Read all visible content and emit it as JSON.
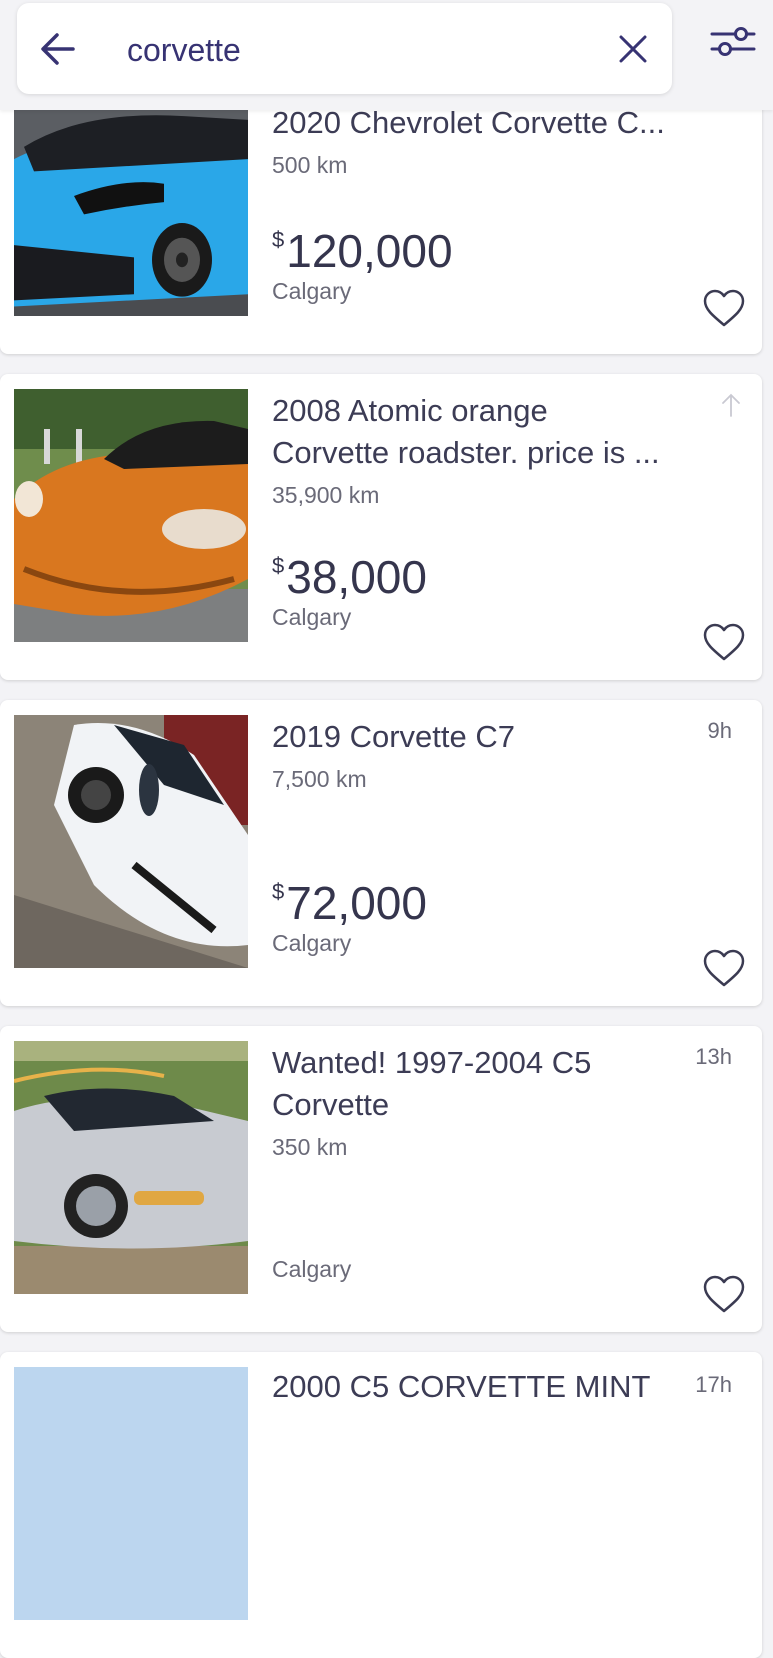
{
  "search": {
    "query": "corvette"
  },
  "icons": {
    "back": "arrow-left-icon",
    "clear": "close-icon",
    "filter": "sliders-icon",
    "favorite": "heart-outline-icon",
    "bump": "arrow-up-icon"
  },
  "colors": {
    "accent": "#373373",
    "background": "#f3f3f6",
    "card": "#ffffff"
  },
  "listings": [
    {
      "title": "2020 Chevrolet Corvette C...",
      "km": "500 km",
      "currency": "$",
      "price": "120,000",
      "location": "Calgary",
      "age": "",
      "car_color": "#2aa7e8"
    },
    {
      "title": "2008 Atomic orange\nCorvette roadster. price is ...",
      "km": "35,900 km",
      "currency": "$",
      "price": "38,000",
      "location": "Calgary",
      "age": "",
      "car_color": "#d9771f"
    },
    {
      "title": "2019 Corvette C7",
      "km": "7,500 km",
      "currency": "$",
      "price": "72,000",
      "location": "Calgary",
      "age": "9h",
      "car_color": "#f1f3f6"
    },
    {
      "title": "Wanted! 1997-2004 C5\nCorvette",
      "km": "350 km",
      "currency": "",
      "price": "",
      "location": "Calgary",
      "age": "13h",
      "car_color": "#c8cbd1"
    },
    {
      "title": "2000 C5 CORVETTE MINT",
      "km": "",
      "currency": "",
      "price": "",
      "location": "",
      "age": "17h",
      "car_color": "#bcd6ef"
    }
  ]
}
